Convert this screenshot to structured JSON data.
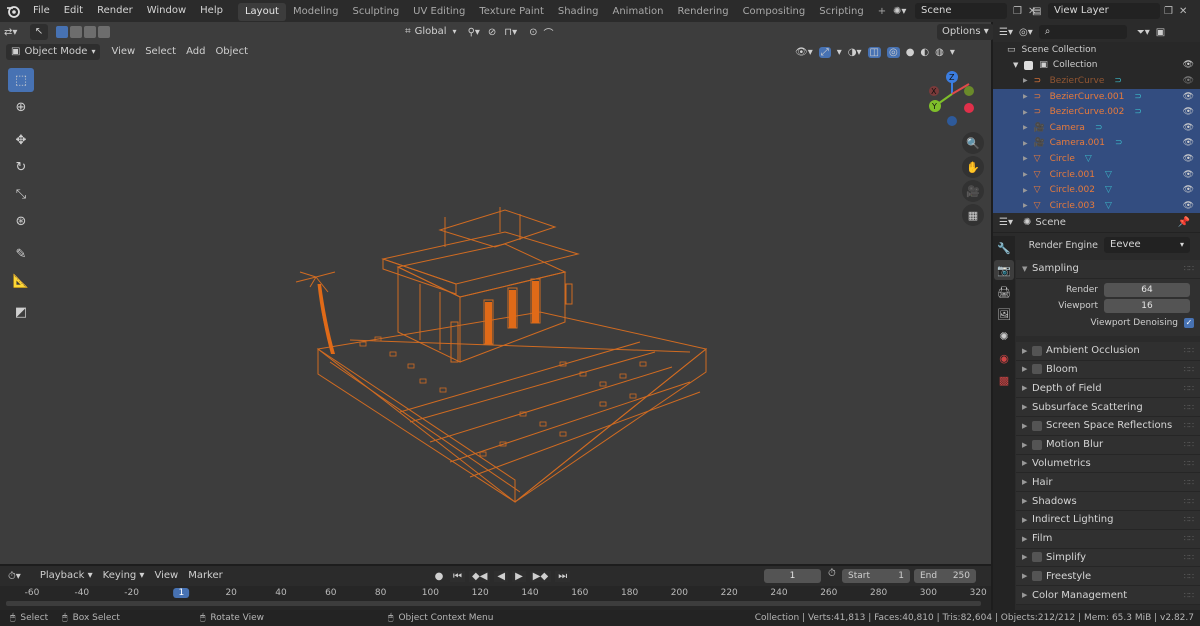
{
  "app": {
    "logo_icon": "blender-logo-icon"
  },
  "menus": [
    "File",
    "Edit",
    "Render",
    "Window",
    "Help"
  ],
  "workspaces": [
    {
      "label": "Layout",
      "active": true
    },
    {
      "label": "Modeling"
    },
    {
      "label": "Sculpting"
    },
    {
      "label": "UV Editing"
    },
    {
      "label": "Texture Paint"
    },
    {
      "label": "Shading"
    },
    {
      "label": "Animation"
    },
    {
      "label": "Rendering"
    },
    {
      "label": "Compositing"
    },
    {
      "label": "Scripting"
    }
  ],
  "add_workspace": "+",
  "scene_field": "Scene",
  "view_layer_field": "View Layer",
  "viewport_header": {
    "mode": "Object Mode",
    "menu": [
      "View",
      "Select",
      "Add",
      "Object"
    ],
    "transform_orientation": "Global",
    "options": "Options"
  },
  "outliner": {
    "root": "Scene Collection",
    "collection": "Collection",
    "items": [
      {
        "name": "BezierCurve",
        "dim": true
      },
      {
        "name": "BezierCurve.001"
      },
      {
        "name": "BezierCurve.002"
      },
      {
        "name": "Camera"
      },
      {
        "name": "Camera.001"
      },
      {
        "name": "Circle"
      },
      {
        "name": "Circle.001"
      },
      {
        "name": "Circle.002"
      },
      {
        "name": "Circle.003"
      }
    ]
  },
  "properties": {
    "context": "Scene",
    "render_engine_label": "Render Engine",
    "render_engine": "Eevee",
    "sampling": {
      "title": "Sampling",
      "render_label": "Render",
      "render_value": "64",
      "viewport_label": "Viewport",
      "viewport_value": "16",
      "denoise_label": "Viewport Denoising",
      "denoise_checked": true
    },
    "panels": [
      {
        "label": "Ambient Occlusion",
        "checkbox": true
      },
      {
        "label": "Bloom",
        "checkbox": true
      },
      {
        "label": "Depth of Field",
        "checkbox": false
      },
      {
        "label": "Subsurface Scattering",
        "checkbox": false
      },
      {
        "label": "Screen Space Reflections",
        "checkbox": true
      },
      {
        "label": "Motion Blur",
        "checkbox": true
      },
      {
        "label": "Volumetrics",
        "checkbox": false
      },
      {
        "label": "Hair",
        "checkbox": false
      },
      {
        "label": "Shadows",
        "checkbox": false
      },
      {
        "label": "Indirect Lighting",
        "checkbox": false
      },
      {
        "label": "Film",
        "checkbox": false
      },
      {
        "label": "Simplify",
        "checkbox": true
      },
      {
        "label": "Freestyle",
        "checkbox": true
      },
      {
        "label": "Color Management",
        "checkbox": false
      }
    ]
  },
  "timeline": {
    "menu": [
      "Playback",
      "Keying",
      "View",
      "Marker"
    ],
    "current_frame": "1",
    "start_label": "Start",
    "start_value": "1",
    "end_label": "End",
    "end_value": "250",
    "ruler": [
      "-60",
      "-40",
      "-20",
      "1",
      "20",
      "40",
      "60",
      "80",
      "100",
      "120",
      "140",
      "160",
      "180",
      "200",
      "220",
      "240",
      "260",
      "280",
      "300",
      "320"
    ]
  },
  "status_bar": {
    "select": "Select",
    "box_select": "Box Select",
    "rotate_view": "Rotate View",
    "context_menu": "Object Context Menu",
    "stats": "Collection | Verts:41,813 | Faces:40,810 | Tris:82,604 | Objects:212/212 | Mem: 65.3 MiB | v2.82.7"
  },
  "colors": {
    "selection": "#e77a3b",
    "active_blue": "#4772b3",
    "outliner_selected_bg": "#334d80"
  }
}
